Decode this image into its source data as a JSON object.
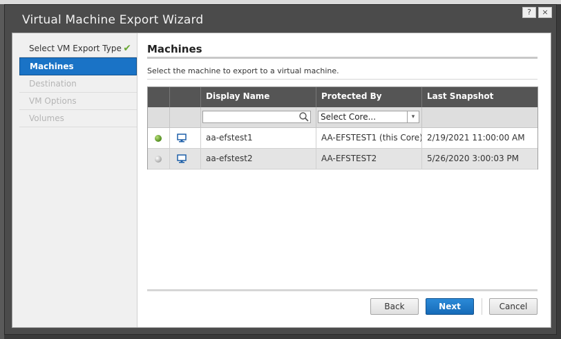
{
  "window": {
    "title": "Virtual Machine Export Wizard",
    "help_label": "?",
    "close_label": "×"
  },
  "steps": [
    {
      "label": "Select VM Export Type",
      "state": "done"
    },
    {
      "label": "Machines",
      "state": "active"
    },
    {
      "label": "Destination",
      "state": "disabled"
    },
    {
      "label": "VM Options",
      "state": "disabled"
    },
    {
      "label": "Volumes",
      "state": "disabled"
    }
  ],
  "main": {
    "title": "Machines",
    "subtitle": "Select the machine to export to a virtual machine."
  },
  "grid": {
    "columns": [
      "",
      "",
      "Display Name",
      "Protected By",
      "Last Snapshot"
    ],
    "filter": {
      "name_value": "",
      "core_select": "Select Core..."
    },
    "rows": [
      {
        "status": "online",
        "name": "aa-efstest1",
        "protected_by": "AA-EFSTEST1 (this Core)",
        "last_snapshot": "2/19/2021 11:00:00 AM"
      },
      {
        "status": "offline",
        "name": "aa-efstest2",
        "protected_by": "AA-EFSTEST2",
        "last_snapshot": "5/26/2020 3:00:03 PM"
      }
    ]
  },
  "buttons": {
    "back": "Back",
    "next": "Next",
    "cancel": "Cancel"
  },
  "colors": {
    "accent": "#1a73c6",
    "check": "#6aa835",
    "header": "#555555"
  }
}
